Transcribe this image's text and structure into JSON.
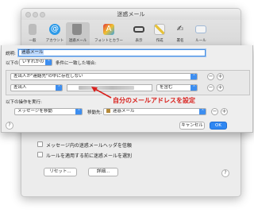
{
  "window": {
    "title": "迷惑メール"
  },
  "toolbar": {
    "items": [
      {
        "label": "一般",
        "icon": "switch-icon"
      },
      {
        "label": "アカウント",
        "icon": "at-icon"
      },
      {
        "label": "迷惑メール",
        "icon": "trash-icon"
      },
      {
        "label": "フォントとカラー",
        "icon": "font-icon"
      },
      {
        "label": "表示",
        "icon": "glasses-icon"
      },
      {
        "label": "作成",
        "icon": "pencil-icon"
      },
      {
        "label": "署名",
        "icon": "signature-icon"
      },
      {
        "label": "ルール",
        "icon": "envelope-icon"
      }
    ]
  },
  "background": {
    "checkboxes": [
      "メッセージ内の迷惑メールヘッダを信頼",
      "ルールを適用する前に迷惑メールを選別"
    ],
    "reset_label": "リセット...",
    "advanced_label": "詳細...",
    "help": "?"
  },
  "sheet": {
    "description_label": "説明:",
    "description_value": "迷惑メール",
    "match_prefix": "以下の",
    "match_select": "いずれかの",
    "match_suffix": "条件に一致した場合:",
    "condition1": "差出人が\"連絡先\"の中に存在しない",
    "condition2_field": "差出人",
    "condition2_op": "を含む",
    "annotation": "自分のメールアドレスを設定",
    "actions_label": "以下の操作を実行:",
    "action1": "メッセージを移動",
    "action_target_label": "移動先:",
    "action_target": "迷惑メール",
    "cancel_label": "キャンセル",
    "ok_label": "OK",
    "help": "?",
    "plus": "+",
    "minus": "−"
  },
  "colors": {
    "accent": "#3d8ef0",
    "annotation": "#d9211d",
    "ok": "#2f87f2"
  }
}
